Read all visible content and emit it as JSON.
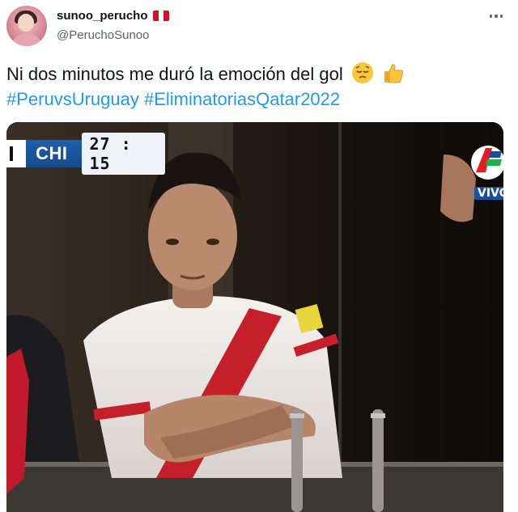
{
  "author": {
    "display_name": "sunoo_perucho",
    "handle": "@PeruchoSunoo",
    "flag_icon": "peru-flag-icon"
  },
  "tweet": {
    "text": "Ni dos minutos me duró la emoción del gol",
    "emojis": [
      "pensive-face-emoji",
      "thumbs-up-emoji"
    ],
    "hashtags": [
      "#PeruvsUruguay",
      "#EliminatoriasQatar2022"
    ]
  },
  "media": {
    "scorebug": {
      "team": "CHI",
      "clock": "27 : 15"
    },
    "channel": {
      "live_label": "VIVO"
    }
  },
  "colors": {
    "link": "#1d9bf0",
    "secondary_text": "#536471",
    "peru_red": "#d91023"
  }
}
